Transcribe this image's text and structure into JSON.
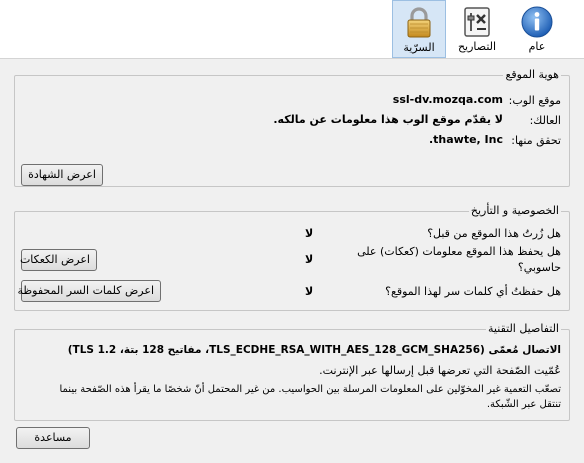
{
  "toolbar": {
    "tabs": [
      {
        "label": "عام",
        "icon": "info-icon"
      },
      {
        "label": "التصاريح",
        "icon": "permissions-icon"
      },
      {
        "label": "السرّية",
        "icon": "lock-icon",
        "selected": true
      }
    ]
  },
  "identity": {
    "title": "هوية الموقع",
    "website_label": "موقع الوب:",
    "website_value": "ssl-dv.mozqa.com",
    "owner_label": "العالك:",
    "owner_value": "لا يقدّم موقع الوب هذا معلومات عن مالكه.",
    "verified_label": "تحقق منها:",
    "verified_value": "thawte, Inc.",
    "view_cert_button": "اعرض الشهادة"
  },
  "privacy": {
    "title": "الخصوصية و التأريخ",
    "q_visited": "هل زُرتُ هذا الموقع من قبل؟",
    "a_visited": "لا",
    "q_cookies_line1": "هل يحفظ هذا الموقع معلومات (كعكات) على",
    "q_cookies_line2": "حاسوبي؟",
    "a_cookies": "لا",
    "view_cookies_button": "اعرض الكعكات",
    "q_passwords": "هل حفظتُ أي كلمات سر لهذا الموقع؟",
    "a_passwords": "لا",
    "view_passwords_button": "اعرض كلمات السر المحفوظة"
  },
  "technical": {
    "title": "التفاصيل التقنية",
    "connection": "الاتصال مُعمّى (TLS_ECDHE_RSA_WITH_AES_128_GCM_SHA256، مفاتيح 128 بتة، TLS 1.2)",
    "encrypted_line": "عُمّيت الصّفحة التي تعرضها قبل إرسالها عبر الإنترنت.",
    "explain_line1": "تصعّب التعمية غير المخوّلين على المعلومات المرسلة بين الحواسيب. من غير المحتمل أنّ شخصًا ما يقرأ هذه الصّفحة بينما",
    "explain_line2": "تنتقل عبر الشّبكة."
  },
  "help_button": "مساعدة",
  "colors": {
    "panel_bg": "#f0f0f0",
    "selected_tab_bg": "#d6e6f6",
    "selected_tab_border": "#9cbfe2",
    "group_border": "#c6c6c6",
    "info_blue": "#2a6fc9",
    "lock_gold": "#d8a631"
  }
}
